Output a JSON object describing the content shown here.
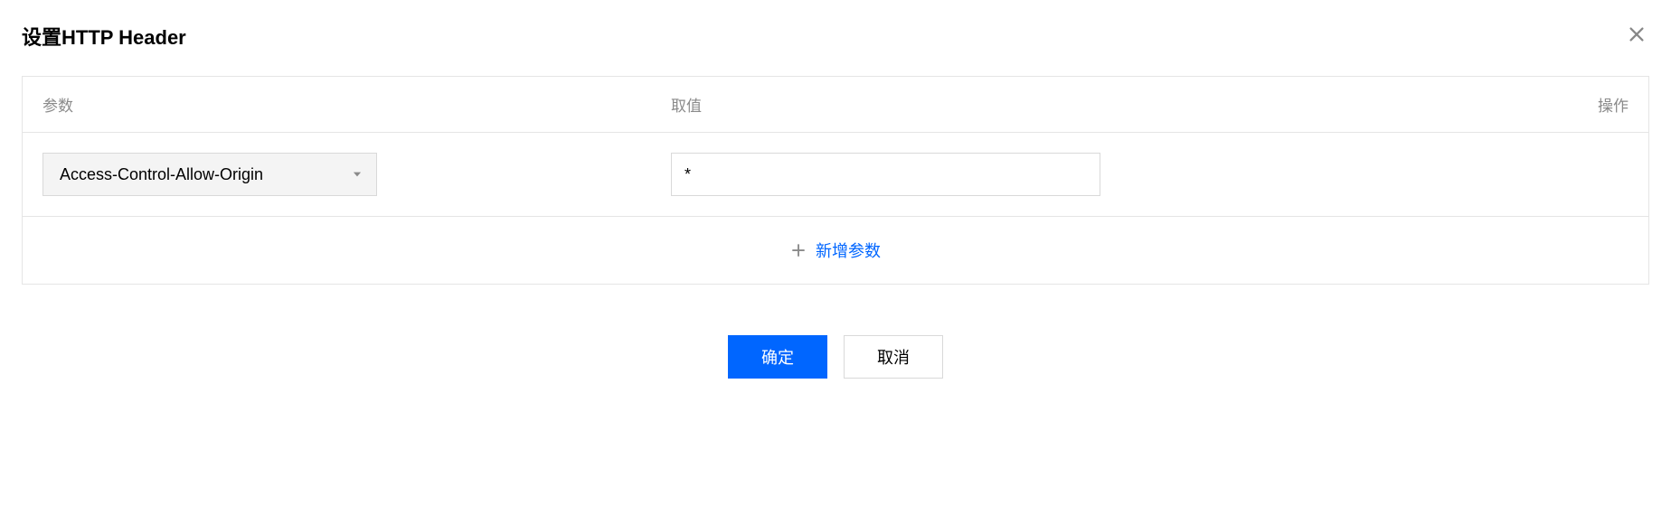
{
  "dialog": {
    "title": "设置HTTP Header"
  },
  "table": {
    "headers": {
      "param": "参数",
      "value": "取值",
      "action": "操作"
    },
    "rows": [
      {
        "param_selected": "Access-Control-Allow-Origin",
        "value": "*"
      }
    ],
    "add_label": "新增参数"
  },
  "footer": {
    "confirm": "确定",
    "cancel": "取消"
  }
}
